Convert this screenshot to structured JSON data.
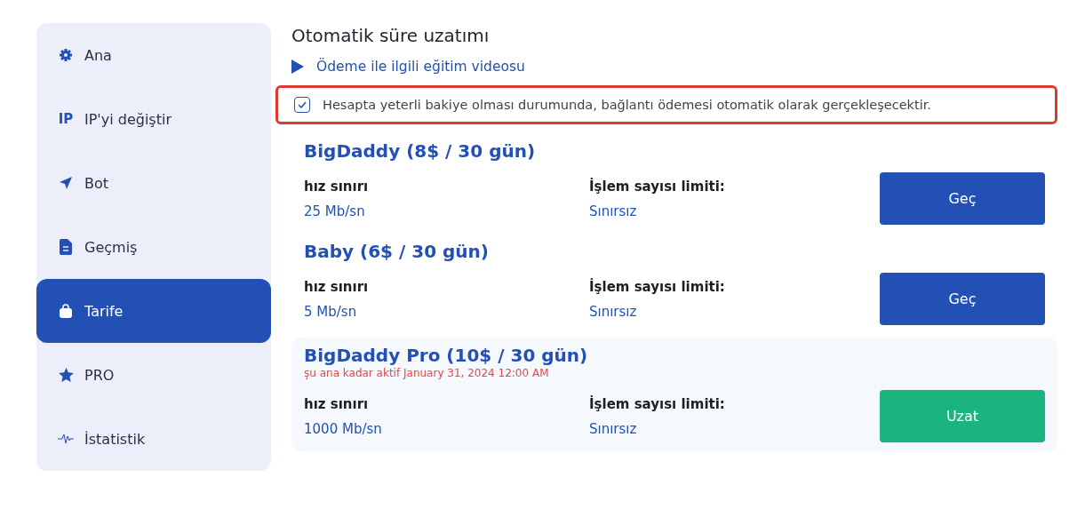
{
  "sidebar": {
    "items": [
      {
        "label": "Ana",
        "selected": false
      },
      {
        "label": "IP'yi değiştir",
        "icon_text": "IP",
        "selected": false
      },
      {
        "label": "Bot",
        "selected": false
      },
      {
        "label": "Geçmiş",
        "selected": false
      },
      {
        "label": "Tarife",
        "selected": true
      },
      {
        "label": "PRO",
        "selected": false
      },
      {
        "label": "İstatistik",
        "selected": false
      }
    ]
  },
  "main": {
    "title": "Otomatik süre uzatımı",
    "video_link": "Ödeme ile ilgili eğitim videosu",
    "auto_renew": {
      "label": "Hesapta yeterli bakiye olması durumunda, bağlantı ödemesi otomatik olarak gerçekleşecektir.",
      "checked": true,
      "highlighted": true
    },
    "plans": [
      {
        "name": "BigDaddy (8$ / 30 gün)",
        "active": false,
        "speed_label": "hız sınırı",
        "speed": "25 Mb/sn",
        "ops_label": "İşlem sayısı limiti:",
        "ops": "Sınırsız",
        "button": "Geç"
      },
      {
        "name": "Baby (6$ / 30 gün)",
        "active": false,
        "speed_label": "hız sınırı",
        "speed": "5 Mb/sn",
        "ops_label": "İşlem sayısı limiti:",
        "ops": "Sınırsız",
        "button": "Geç"
      },
      {
        "name": "BigDaddy Pro (10$ / 30 gün)",
        "active": true,
        "note": "şu ana kadar aktif January 31, 2024 12:00 AM",
        "speed_label": "hız sınırı",
        "speed": "1000 Mb/sn",
        "ops_label": "İşlem sayısı limiti:",
        "ops": "Sınırsız",
        "button": "Uzat"
      }
    ]
  }
}
